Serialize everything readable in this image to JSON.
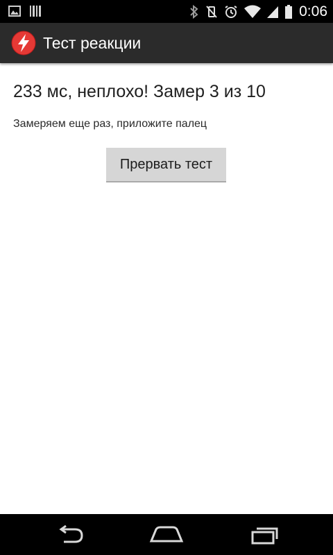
{
  "status_bar": {
    "time": "0:06",
    "icons": [
      "picture-icon",
      "barcode-icon",
      "bluetooth-icon",
      "vibrate-off-icon",
      "alarm-icon",
      "wifi-icon",
      "signal-icon",
      "battery-icon"
    ]
  },
  "action_bar": {
    "title": "Тест реакции",
    "app_icon": "lightning-icon",
    "icon_color": "#e53935"
  },
  "content": {
    "result": "233 мс, неплохо! Замер 3 из 10",
    "instruction": "Замеряем еще раз, приложите палец",
    "stop_button_label": "Прервать тест"
  },
  "nav_bar": {
    "buttons": [
      "back-icon",
      "home-icon",
      "recent-apps-icon"
    ]
  }
}
